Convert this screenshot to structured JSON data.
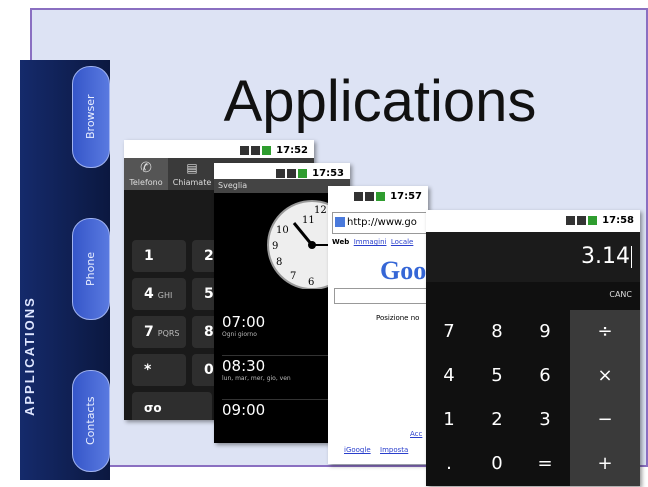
{
  "slide": {
    "title": "Applications"
  },
  "sidebar": {
    "vertical_label": "APPLICATIONS",
    "buttons": [
      "Browser",
      "Phone",
      "Contacts"
    ]
  },
  "dialer": {
    "time": "17:52",
    "tabs": [
      "Telefono",
      "Chiamate"
    ],
    "keys": [
      {
        "num": "1",
        "letters": ""
      },
      {
        "num": "2",
        "letters": ""
      },
      {
        "num": "4",
        "letters": "GHI"
      },
      {
        "num": "5",
        "letters": ""
      },
      {
        "num": "7",
        "letters": "PQRS"
      },
      {
        "num": "8",
        "letters": ""
      },
      {
        "num": "*",
        "letters": ""
      },
      {
        "num": "0",
        "letters": ""
      }
    ],
    "voicemail_glyph": "σο"
  },
  "alarm": {
    "time": "17:53",
    "header": "Sveglia",
    "clock_numbers": [
      "11",
      "12",
      "10",
      "9",
      "8",
      "7",
      "6"
    ],
    "items": [
      {
        "time": "07:00",
        "days": "Ogni giorno"
      },
      {
        "time": "08:30",
        "days": "lun, mar, mer, gio, ven"
      },
      {
        "time": "09:00",
        "days": ""
      }
    ]
  },
  "browser": {
    "time": "17:57",
    "url": "http://www.go",
    "links": [
      "Web",
      "Immagini",
      "Locale"
    ],
    "logo": "Goo",
    "position_text": "Posizione no",
    "footer_partial": "Acc",
    "footer_links": [
      "iGoogle",
      "Imposta"
    ]
  },
  "calculator": {
    "time": "17:58",
    "display": "3.14",
    "clear_label": "CANC",
    "keys": [
      "7",
      "8",
      "9",
      "÷",
      "4",
      "5",
      "6",
      "×",
      "1",
      "2",
      "3",
      "−",
      ".",
      "0",
      "=",
      "+"
    ]
  }
}
